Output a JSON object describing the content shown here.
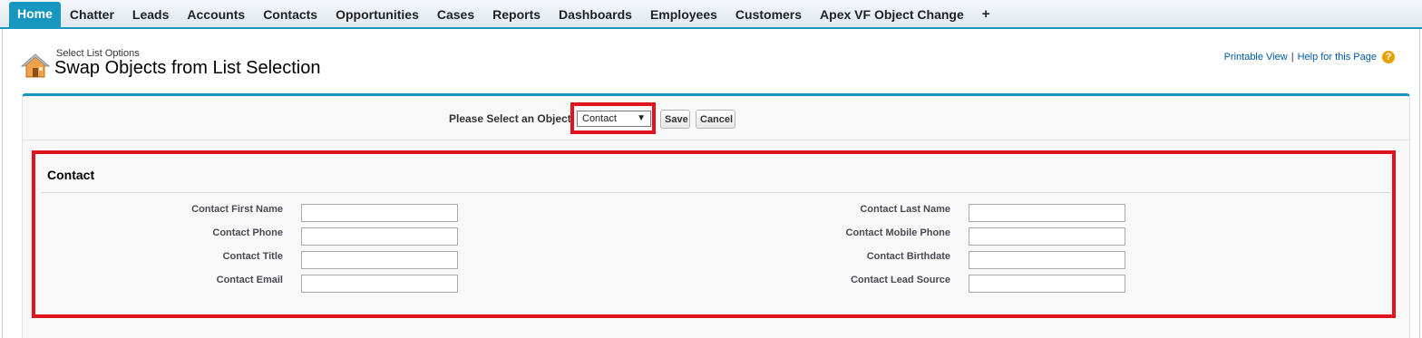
{
  "tabs": [
    "Home",
    "Chatter",
    "Leads",
    "Accounts",
    "Contacts",
    "Opportunities",
    "Cases",
    "Reports",
    "Dashboards",
    "Employees",
    "Customers",
    "Apex VF Object Change",
    "+"
  ],
  "active_tab": "Home",
  "header": {
    "page_type": "Select List Options",
    "title": "Swap Objects from List Selection",
    "printable_view": "Printable View",
    "separator": "|",
    "help_link": "Help for this Page",
    "help_icon": "?"
  },
  "selector": {
    "label": "Please Select an Object",
    "selected": "Contact",
    "arrow": "▼",
    "save": "Save",
    "cancel": "Cancel"
  },
  "section": {
    "title": "Contact",
    "left_fields": [
      {
        "label": "Contact First Name",
        "value": ""
      },
      {
        "label": "Contact Phone",
        "value": ""
      },
      {
        "label": "Contact Title",
        "value": ""
      },
      {
        "label": "Contact Email",
        "value": ""
      }
    ],
    "right_fields": [
      {
        "label": "Contact Last Name",
        "value": ""
      },
      {
        "label": "Contact Mobile Phone",
        "value": ""
      },
      {
        "label": "Contact Birthdate",
        "value": ""
      },
      {
        "label": "Contact Lead Source",
        "value": ""
      }
    ]
  },
  "colors": {
    "accent": "#1797c0",
    "highlight": "#e0141e",
    "link": "#015ba7"
  }
}
